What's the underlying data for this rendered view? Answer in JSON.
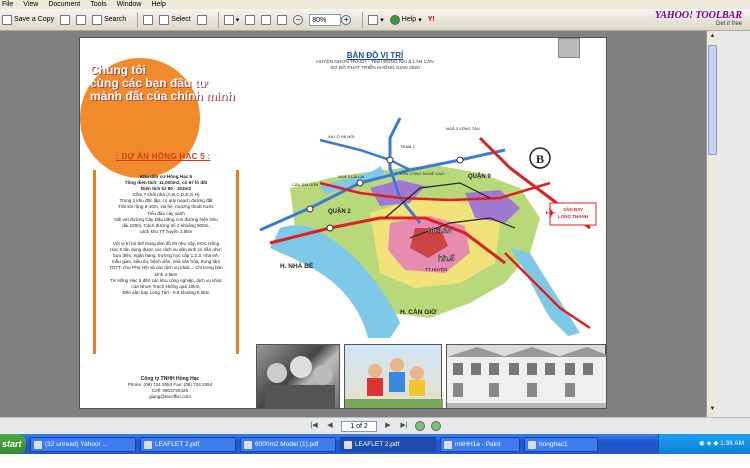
{
  "menu": [
    "File",
    "View",
    "Document",
    "Tools",
    "Window",
    "Help"
  ],
  "toolbar": {
    "save": "Save a Copy",
    "search": "Search",
    "select": "Select",
    "zoom": "80%",
    "help": "Help"
  },
  "yahoo": {
    "brand": "YAHOO! TOOLBAR",
    "cta": "Get it free"
  },
  "leaflet": {
    "slogan": "Chúng tôi\ncùng các bạn đầu tư\nmảnh đất của chính mình",
    "project_title": ": DỰ ÁN HỒNG HẠC 5 :",
    "info_lines": [
      "Khu dân cư Hồng Hạc 5",
      "Tổng diện tích: 11,000m2, có 67 lô đất",
      "Diện tích từ 80 - 153m2",
      "Gồm 7 khối nhà (A,B,C,D,E,G,H)",
      "Trong 1 khu độc lập, có quy hoạch đường đất",
      "Trải sỏi rộng 6-10m, vỉa hè, mương thoát nước",
      "Tiểu đảo cây xanh",
      "Nối với đường Cây Dầu bằng con đường hiện hữu",
      "dài 100m, Cách đường số 2 khoảng 500m,",
      "cách khu TT huyện 1.5km",
      "",
      "Với vị trí lợi thế trung tâm đô thị như vậy, KDC Hồng",
      "Hạc 5 tận dụng được các dịch vụ dân sinh có sẵn như:",
      "bưu điện, ngân hàng, trường học cấp 1,2,3, nhà trẻ,",
      "mẫu giáo, siêu thị, bệnh viện, nhà văn hóa, trung tâm",
      "TDTT, chợ Phú Hội và các dịch vụ khác... Chỉ trong bán",
      "kính 2-5km",
      "Từ Hồng Hạc 5 đến các khu công nghiệp, dịch vụ khác",
      "của Nhơn Trạch không quá 10km,",
      "Đến sân bay Long Tân - 0.9 khoảng 6.5km"
    ],
    "company": {
      "name": "Công ty TNHH Hồng Hạc",
      "phone": "Phone: (08) 724 2654    Fax: (08) 724 2654",
      "cell": "Cell: 0903720425",
      "email": "giang@tecoffvn.com"
    },
    "map": {
      "title": "BẢN ĐỒ VỊ TRÍ",
      "subtitle": "HUYỆN NHƠN TRẠCH - TỈNH ĐỒNG NAI & LÂN CẬN",
      "subtitle2": "SƠ ĐỒ PHÁT TRIỂN KHÔNG GIAN 2020",
      "labels": {
        "quan2": "QUẬN 2",
        "quan9": "QUẬN 9",
        "hh13": "hh.1&3",
        "hh5": "hh.5",
        "nhabe": "H. NHÀ BÈ",
        "cangio": "H. CẦN GIỜ",
        "sanbay": "SÂN BAY LONG THÀNH",
        "trungtam": "TT HUYỆN",
        "compass": "B",
        "cauSaiGon": "CẦU SÀI GÒN",
        "ngaBaLaiLai": "NGÃ 3 LÁI LAI",
        "tram2": "TRẠM 2",
        "khuCongNghe": "KHU CÔNG NGHỆ CAO",
        "vongTau": "NGÃ 3 VŨNG TÀU",
        "laHaNoi": "XA LỘ HÀ NỘI"
      }
    }
  },
  "page_nav": {
    "page": "1 of 2"
  },
  "taskbar": {
    "start": "start",
    "tasks": [
      "(32 unread) Yahoo! ...",
      "LEAFLET 2.pdf",
      "6000m2 Model (1).pdf",
      "LEAFLET 2.pdf",
      "mliHH1a - Paint",
      "honghac1"
    ],
    "time": "1:36 AM"
  }
}
